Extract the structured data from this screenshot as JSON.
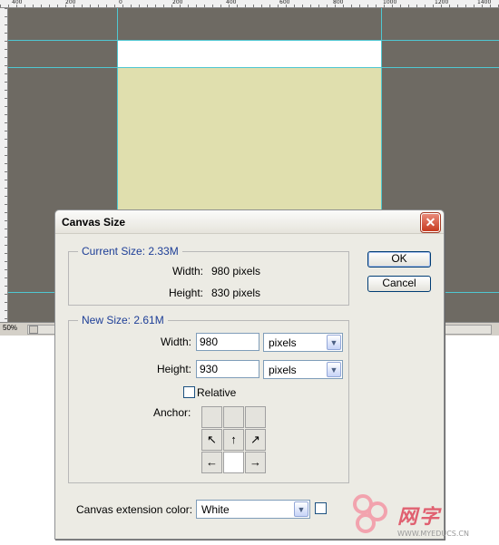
{
  "workspace": {
    "ruler_top": [
      "400",
      "200",
      "0",
      "200",
      "400",
      "600",
      "800",
      "1000",
      "1200",
      "1400"
    ],
    "zoom": "50%"
  },
  "dialog": {
    "title": "Canvas Size",
    "close_glyph": "✕",
    "ok_label": "OK",
    "cancel_label": "Cancel",
    "current_size": {
      "legend": "Current Size: 2.33M",
      "width_label": "Width:",
      "width_value": "980 pixels",
      "height_label": "Height:",
      "height_value": "830 pixels"
    },
    "new_size": {
      "legend": "New Size: 2.61M",
      "width_label": "Width:",
      "width_value": "980",
      "width_unit": "pixels",
      "height_label": "Height:",
      "height_value": "930",
      "height_unit": "pixels",
      "relative_label": "Relative",
      "relative_checked": false,
      "anchor_label": "Anchor:",
      "anchor_arrows": [
        "",
        "",
        "",
        "↖",
        "↑",
        "↗",
        "←",
        "",
        "→"
      ]
    },
    "extension_color_label": "Canvas extension color:",
    "extension_color_value": "White",
    "extension_swatch_color": "#ffffff"
  },
  "watermark": {
    "chars": "网字",
    "url": "WWW.MYEDUCS.CN"
  },
  "colors": {
    "workspace_bg": "#6e6a63",
    "canvas_fill": "#e0dfae",
    "guide": "#4fc7d2",
    "legend_text": "#1d3e97",
    "close_red": "#c73b20"
  }
}
